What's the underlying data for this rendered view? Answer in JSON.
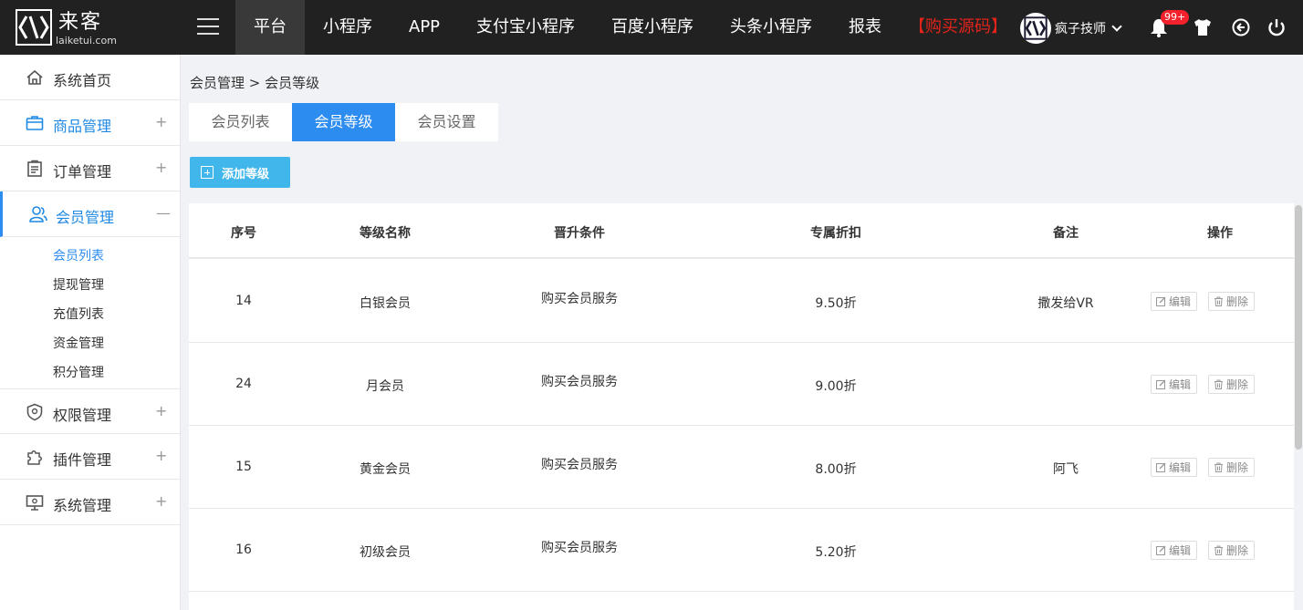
{
  "brand": {
    "name": "来客",
    "url": "laiketui.com"
  },
  "nav": {
    "items": [
      "平台",
      "小程序",
      "APP",
      "支付宝小程序",
      "百度小程序",
      "头条小程序",
      "报表"
    ],
    "buy_label": "【购买源码】"
  },
  "user": {
    "name": "疯子技师",
    "notif_badge": "99+"
  },
  "sidebar": {
    "items": [
      "系统首页",
      "商品管理",
      "订单管理",
      "会员管理",
      "权限管理",
      "插件管理",
      "系统管理"
    ],
    "collapse_symbol": "—",
    "expand_symbol": "+",
    "member_sub": [
      "会员列表",
      "提现管理",
      "充值列表",
      "资金管理",
      "积分管理"
    ]
  },
  "breadcrumb": "会员管理 > 会员等级",
  "tabs": [
    "会员列表",
    "会员等级",
    "会员设置"
  ],
  "add_button": "添加等级",
  "table": {
    "headers": [
      "序号",
      "等级名称",
      "晋升条件",
      "专属折扣",
      "备注",
      "操作"
    ],
    "rows": [
      {
        "id": "14",
        "name": "白银会员",
        "condition": "购买会员服务",
        "discount": "9.50折",
        "remark": "撒发给VR"
      },
      {
        "id": "24",
        "name": "月会员",
        "condition": "购买会员服务",
        "discount": "9.00折",
        "remark": ""
      },
      {
        "id": "15",
        "name": "黄金会员",
        "condition": "购买会员服务",
        "discount": "8.00折",
        "remark": "阿飞"
      },
      {
        "id": "16",
        "name": "初级会员",
        "condition": "购买会员服务",
        "discount": "5.20折",
        "remark": ""
      }
    ],
    "edit_label": "编辑",
    "delete_label": "删除"
  },
  "colors": {
    "accent": "#2d8cf0",
    "add_button": "#41b6ea",
    "topbar": "#212121",
    "buy": "#e2231a"
  }
}
